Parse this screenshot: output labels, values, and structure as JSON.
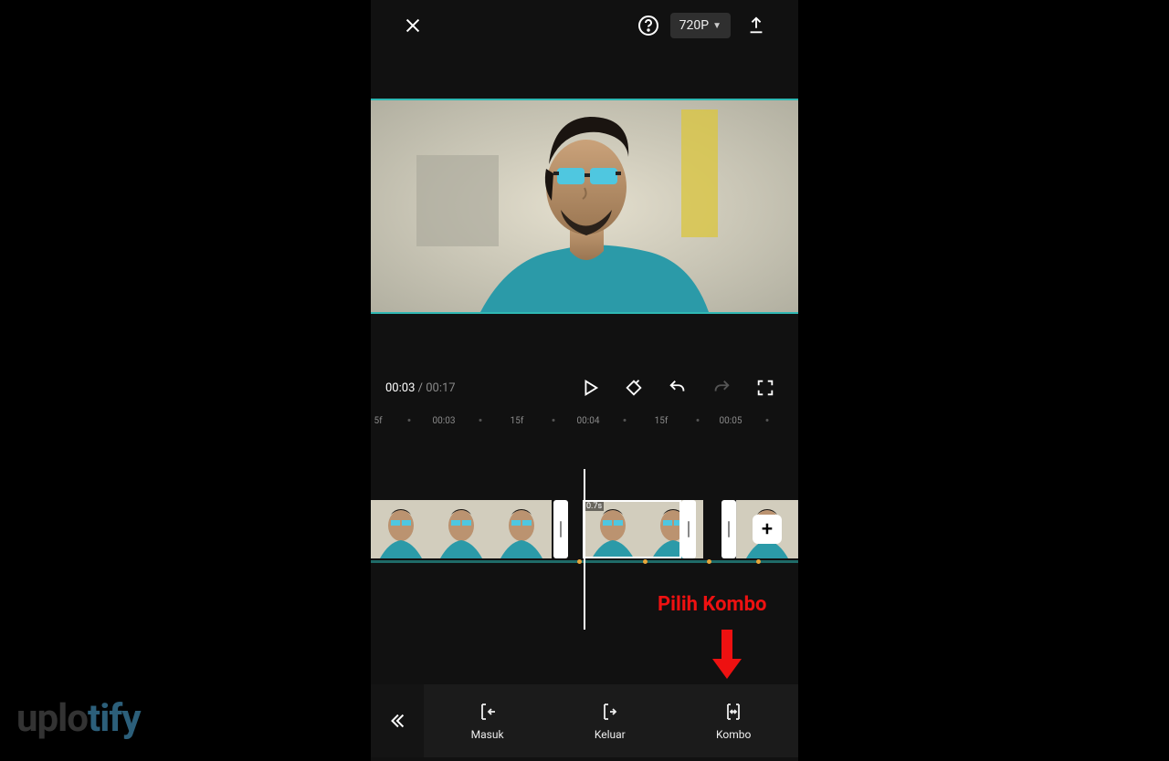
{
  "topbar": {
    "resolution_label": "720P"
  },
  "transport": {
    "current_time": "00:03",
    "separator": " / ",
    "total_time": "00:17"
  },
  "ruler": {
    "marks": [
      "5f",
      "00:03",
      "15f",
      "00:04",
      "15f",
      "00:05"
    ]
  },
  "timeline": {
    "selected_duration": "0.7s"
  },
  "annotation": {
    "text": "Pilih Kombo"
  },
  "actions": {
    "masuk": "Masuk",
    "keluar": "Keluar",
    "kombo": "Kombo"
  },
  "watermark": {
    "part1": "uplo",
    "part2": "tify"
  },
  "colors": {
    "accent_teal": "#2fb8b3",
    "annotation_red": "#e11"
  }
}
